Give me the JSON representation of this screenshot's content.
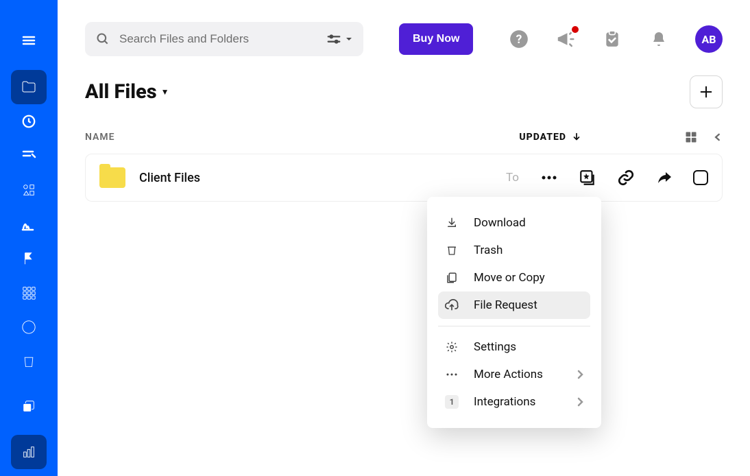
{
  "header": {
    "search_placeholder": "Search Files and Folders",
    "buy_label": "Buy Now",
    "avatar_initials": "AB"
  },
  "page": {
    "title": "All Files"
  },
  "list": {
    "col_name": "NAME",
    "col_updated": "UPDATED",
    "rows": [
      {
        "name": "Client Files",
        "updated": "To"
      }
    ]
  },
  "menu": {
    "download": "Download",
    "trash": "Trash",
    "move_copy": "Move or Copy",
    "file_request": "File Request",
    "settings": "Settings",
    "more_actions": "More Actions",
    "integrations": "Integrations",
    "integrations_badge": "1"
  }
}
